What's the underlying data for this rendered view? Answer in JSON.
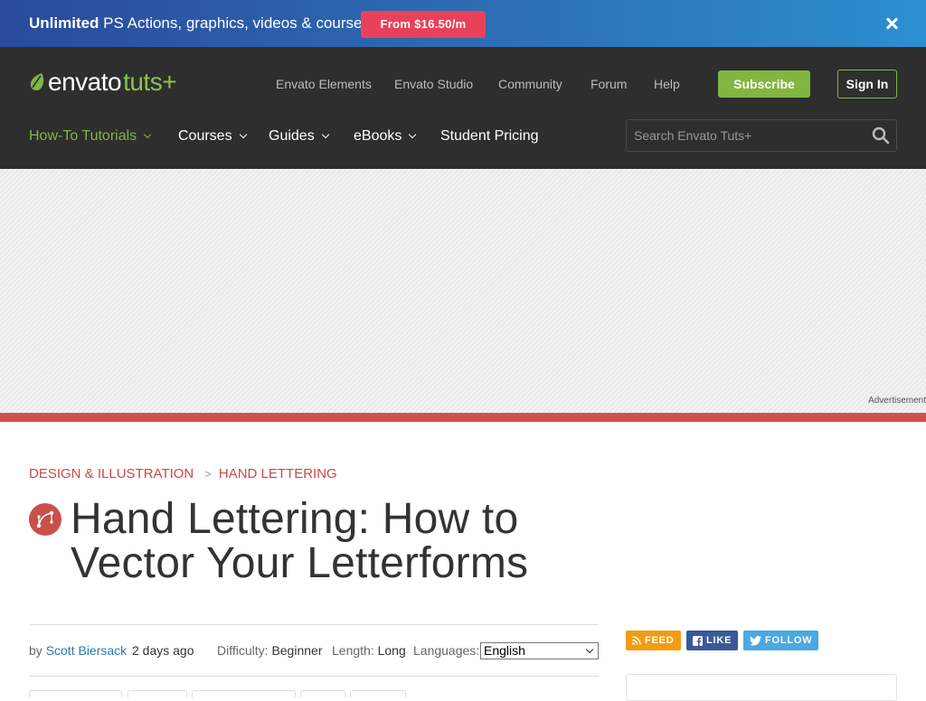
{
  "promo": {
    "bold": "Unlimited",
    "text": " PS Actions, graphics, videos & courses!",
    "button": "From $16.50/m"
  },
  "header": {
    "logo": {
      "envato": "envato",
      "tuts": "tuts+"
    },
    "top_nav": [
      "Envato Elements",
      "Envato Studio",
      "Community",
      "Forum",
      "Help"
    ],
    "subscribe": "Subscribe",
    "sign_in": "Sign In",
    "main_nav": [
      {
        "label": "How-To Tutorials",
        "active": true
      },
      {
        "label": "Courses"
      },
      {
        "label": "Guides"
      },
      {
        "label": "eBooks"
      },
      {
        "label": "Student Pricing"
      }
    ],
    "search": {
      "placeholder": "Search Envato Tuts+"
    }
  },
  "ad": {
    "label": "Advertisement"
  },
  "article": {
    "breadcrumb": {
      "category": "DESIGN & ILLUSTRATION",
      "separator": ">",
      "subcategory": "HAND LETTERING"
    },
    "title": "Hand Lettering: How to Vector Your Letterforms",
    "meta": {
      "by": "by",
      "author": "Scott Biersack",
      "date": "2 days ago",
      "difficulty_label": "Difficulty:",
      "difficulty": "Beginner",
      "length_label": "Length:",
      "length": "Long",
      "languages_label": "Languages:",
      "language_selected": "English"
    }
  },
  "social": {
    "feed": "FEED",
    "like": "LIKE",
    "follow": "FOLLOW"
  },
  "colors": {
    "accent_green": "#82b541",
    "category_red": "#c84b45",
    "header_bg": "#2e2e2e",
    "promo_pink": "#e8415b"
  }
}
